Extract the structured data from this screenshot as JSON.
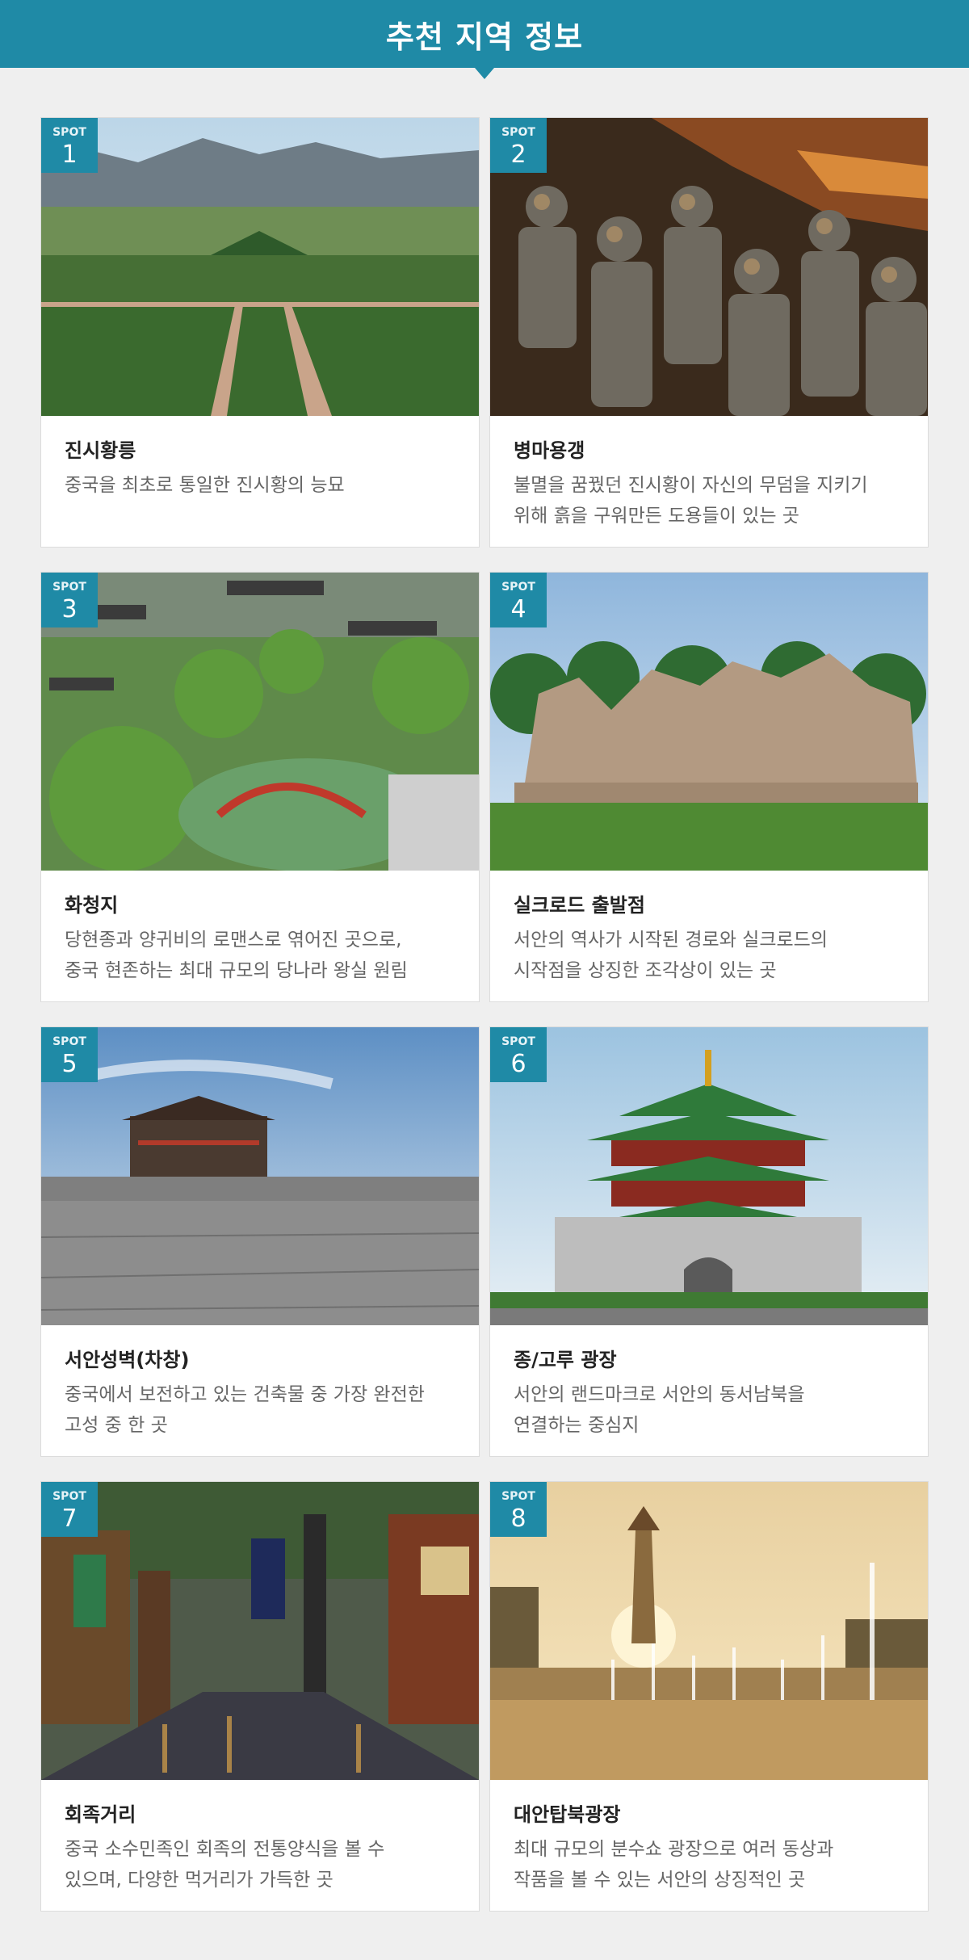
{
  "header": {
    "title": "추천 지역 정보"
  },
  "badge_label": "SPOT",
  "spots": [
    {
      "num": "1",
      "title": "진시황릉",
      "desc1": "중국을 최초로 통일한 진시황의 능묘",
      "desc2": ""
    },
    {
      "num": "2",
      "title": "병마용갱",
      "desc1": "불멸을 꿈꿨던 진시황이 자신의 무덤을 지키기",
      "desc2": "위해 흙을 구워만든 도용들이 있는 곳"
    },
    {
      "num": "3",
      "title": "화청지",
      "desc1": "당현종과 양귀비의 로맨스로 엮어진 곳으로,",
      "desc2": "중국 현존하는 최대 규모의 당나라 왕실 원림"
    },
    {
      "num": "4",
      "title": "실크로드 출발점",
      "desc1": "서안의 역사가 시작된 경로와 실크로드의",
      "desc2": "시작점을 상징한 조각상이 있는 곳"
    },
    {
      "num": "5",
      "title": "서안성벽(차창)",
      "desc1": "중국에서 보전하고 있는 건축물 중 가장 완전한",
      "desc2": "고성 중 한 곳"
    },
    {
      "num": "6",
      "title": "종/고루 광장",
      "desc1": "서안의 랜드마크로 서안의 동서남북을",
      "desc2": "연결하는 중심지"
    },
    {
      "num": "7",
      "title": "회족거리",
      "desc1": "중국 소수민족인 회족의 전통양식을 볼 수",
      "desc2": "있으며, 다양한 먹거리가 가득한 곳"
    },
    {
      "num": "8",
      "title": "대안탑북광장",
      "desc1": "최대 규모의 분수쇼 광장으로 여러 동상과",
      "desc2": "작품을 볼 수 있는 서안의 상징적인 곳"
    }
  ],
  "colors": {
    "accent": "#1f8aa6",
    "background": "#efefef",
    "title": "#222222",
    "desc": "#666666"
  }
}
